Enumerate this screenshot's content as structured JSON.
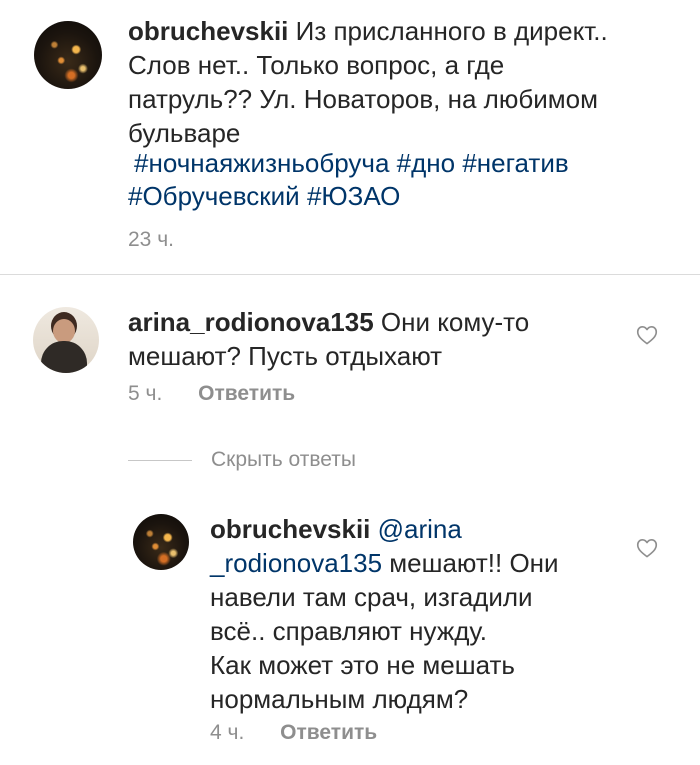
{
  "post": {
    "username": "obruchevskii",
    "text_line1": "Из присланного в директ..",
    "text_line2": "Слов нет.. Только вопрос, а где",
    "text_line3": "патруль?? Ул. Новаторов, на любимом",
    "text_line4": "бульваре",
    "hashtags_line1": [
      "#ночнаяжизньобруча",
      "#дно",
      "#негатив"
    ],
    "hashtags_line2": [
      "#Обручевский",
      "#ЮЗАО"
    ],
    "time": "23 ч."
  },
  "comment": {
    "username": "arina_rodionova135",
    "text_line1": "Они кому-то",
    "text_line2": "мешают? Пусть отдыхают",
    "time": "5 ч.",
    "reply_label": "Ответить"
  },
  "hide_replies_label": "Скрыть ответы",
  "reply": {
    "username": "obruchevskii",
    "mention_line1": "@arina",
    "mention_line2": "_rodionova135",
    "text_after_mention": "мешают!! Они",
    "text_line3": "навели там срач, изгадили",
    "text_line4": "всё.. справляют нужду.",
    "text_line5": "Как может это не мешать",
    "text_line6": "нормальным людям?",
    "time": "4 ч.",
    "reply_label": "Ответить"
  },
  "colors": {
    "text": "#262626",
    "hashtag": "#003569",
    "meta": "#8e8e8e",
    "divider": "#dbdbdb"
  },
  "icons": {
    "like": "heart-outline-icon"
  }
}
